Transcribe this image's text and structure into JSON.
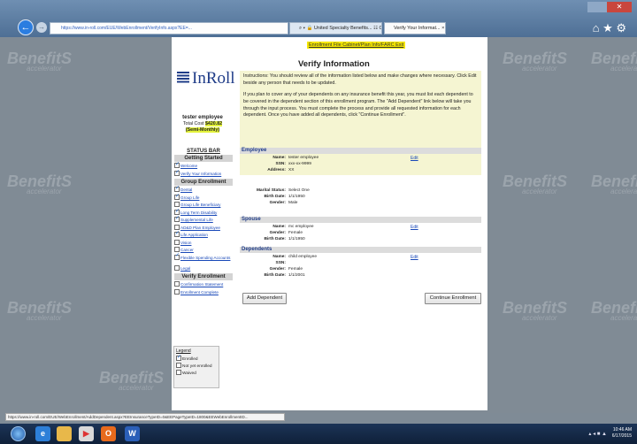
{
  "browser": {
    "url": "https://www.in-roll.com/EUE/WebEnrollment/VerifyInfo.aspx?EE=...",
    "search_glyph": "⌕ ▾ 🔒 United Specialty Benefits... ☷ C ✕",
    "tab_title": "Verify Your Informat...",
    "tab_close": "×",
    "close_glyph": "✕",
    "home_glyph": "⌂ ★ ⚙"
  },
  "watermark": {
    "brand": "BenefitS",
    "tagline": "accelerator"
  },
  "page": {
    "top_links": "Enrollment File Cabinet/Plan Info/FARC Exit",
    "title": "Verify Information",
    "logo": "InRoll"
  },
  "instructions": {
    "para1": "Instructions: You should review all of the information listed below and make changes where necessary. Click Edit beside any person that needs to be updated.",
    "para2": "If you plan to cover any of your dependents on any insurance benefit this year, you must list each dependent to be covered in the dependent section of this enrollment program. The \"Add Dependent\" link below will take you through the input process. You must complete the process and provide all requested information for each dependent. Once you have added all dependents, click \"Continue Enrollment\"."
  },
  "employee_summary": {
    "name": "tester employee",
    "total_cost_label": "Total Cost",
    "total_cost": "$420.82",
    "frequency": "(Semi-Monthly)"
  },
  "sidebar": {
    "title": "STATUS BAR",
    "sections": [
      {
        "heading": "Getting Started",
        "items": [
          {
            "label": "Welcome",
            "checked": true
          },
          {
            "label": "Verify Your Information",
            "checked": true
          }
        ]
      },
      {
        "heading": "Group Enrollment",
        "items": [
          {
            "label": "Dental",
            "checked": true
          },
          {
            "label": "Group Life",
            "checked": true
          },
          {
            "label": "Group Life Beneficiary",
            "checked": false
          },
          {
            "label": "Long Term Disability",
            "checked": true
          },
          {
            "label": "Supplemental Life",
            "checked": true
          },
          {
            "label": "AD&D Plan Employee",
            "checked": false
          },
          {
            "label": "Life Application",
            "checked": true
          },
          {
            "label": "Vision",
            "checked": false
          },
          {
            "label": "Cancer",
            "checked": false
          },
          {
            "label": "Flexible Spending Accounts",
            "checked": true
          },
          {
            "label": "Legal",
            "checked": false
          }
        ]
      },
      {
        "heading": "Verify Enrollment",
        "items": [
          {
            "label": "Confirmation Statement",
            "checked": false
          },
          {
            "label": "Enrollment Complete",
            "checked": false
          }
        ]
      }
    ]
  },
  "legend": {
    "title": "Legend",
    "items": [
      {
        "label": "Enrolled",
        "checked": true
      },
      {
        "label": "Not yet enrolled",
        "checked": false
      },
      {
        "label": "Waived",
        "checked": false
      }
    ]
  },
  "employee": {
    "heading": "Employee",
    "edit": "Edit",
    "name_label": "Name:",
    "name": "tester employee",
    "ssn_label": "SSN:",
    "ssn": "xxx-xx-9999",
    "address_label": "Address:",
    "address": "XX",
    "marital_label": "Marital Status:",
    "marital": "Select One",
    "birth_label": "Birth Date:",
    "birth": "1/1/1950",
    "gender_label": "Gender:",
    "gender": "Male"
  },
  "spouse": {
    "heading": "Spouse",
    "edit": "Edit",
    "name_label": "Name:",
    "name": "mc employee",
    "gender_label": "Gender:",
    "gender": "Female",
    "birth_label": "Birth Date:",
    "birth": "1/1/1950"
  },
  "dependents": {
    "heading": "Dependents",
    "edit": "Edit",
    "name_label": "Name:",
    "name": "child employee",
    "ssn_label": "SSN:",
    "ssn": "",
    "gender_label": "Gender:",
    "gender": "Female",
    "birth_label": "Birth Date:",
    "birth": "1/1/2001"
  },
  "buttons": {
    "add_dependent": "Add Dependent",
    "continue": "Continue Enrollment"
  },
  "status_bar_url": "https://www.in-roll.com/EUE/WebEnrollment/AddDependent.aspx?EEInsuranceTypeID=0&EEPageTypeID=1800&EEWebEnrollmentID...",
  "taskbar": {
    "time": "10:46 AM",
    "date": "6/17/2015",
    "tray": "▴ ◂ ■ ▲"
  }
}
